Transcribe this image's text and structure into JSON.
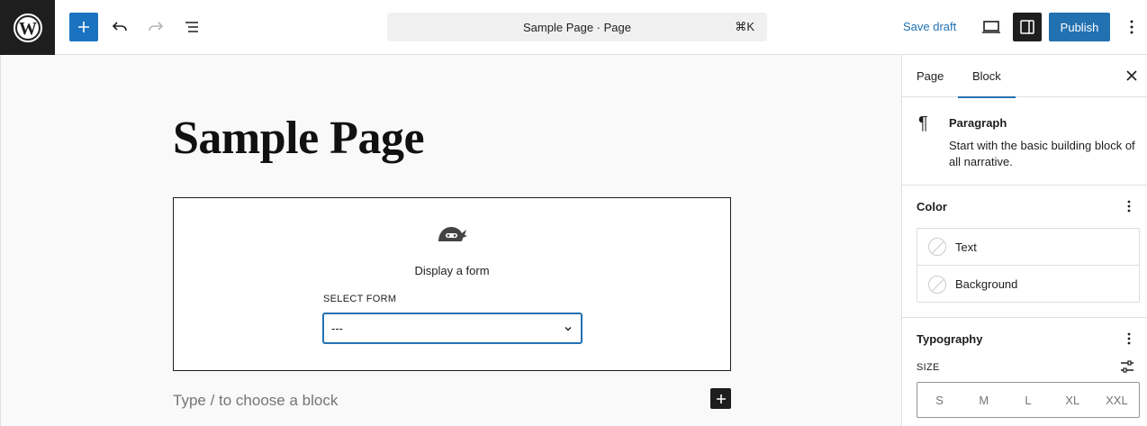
{
  "toolbar": {
    "command_bar": "Sample Page · Page",
    "command_shortcut": "⌘K",
    "save_draft": "Save draft",
    "publish": "Publish"
  },
  "editor": {
    "page_title": "Sample Page",
    "form_block": {
      "heading": "Display a form",
      "select_label": "SELECT FORM",
      "select_value": "---"
    },
    "placeholder": "Type / to choose a block"
  },
  "sidebar": {
    "tabs": [
      {
        "label": "Page",
        "active": false
      },
      {
        "label": "Block",
        "active": true
      }
    ],
    "block": {
      "name": "Paragraph",
      "description": "Start with the basic building block of all narrative."
    },
    "color": {
      "title": "Color",
      "items": [
        "Text",
        "Background"
      ]
    },
    "typography": {
      "title": "Typography",
      "size_label": "SIZE",
      "sizes": [
        "S",
        "M",
        "L",
        "XL",
        "XXL"
      ]
    }
  },
  "colors": {
    "accent": "#2271b1",
    "dark": "#1e1e1e"
  }
}
